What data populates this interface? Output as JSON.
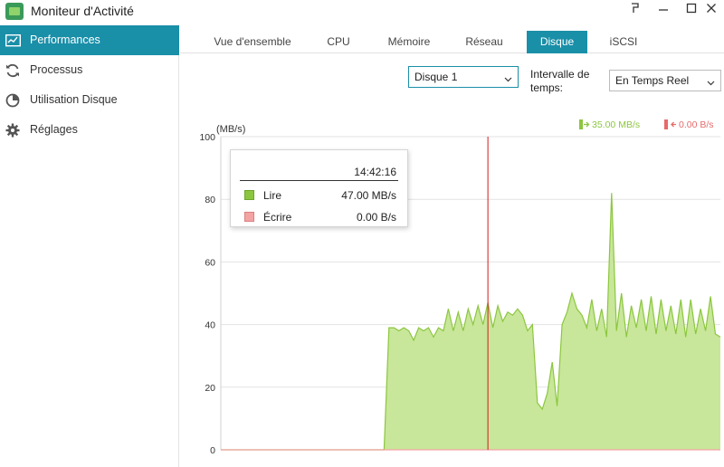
{
  "window": {
    "title": "Moniteur d'Activité",
    "controls": [
      "pin-icon",
      "minimize-icon",
      "maximize-icon",
      "close-icon"
    ]
  },
  "sidebar": {
    "items": [
      {
        "label": "Performances",
        "icon": "performance-monitor-icon",
        "active": true
      },
      {
        "label": "Processus",
        "icon": "refresh-cycle-icon",
        "active": false
      },
      {
        "label": "Utilisation Disque",
        "icon": "disk-pie-icon",
        "active": false
      },
      {
        "label": "Réglages",
        "icon": "gear-icon",
        "active": false
      }
    ]
  },
  "tabs": {
    "items": [
      {
        "label": "Vue d'ensemble"
      },
      {
        "label": "CPU"
      },
      {
        "label": "Mémoire"
      },
      {
        "label": "Réseau"
      },
      {
        "label": "Disque"
      },
      {
        "label": "iSCSI"
      }
    ],
    "active": "Disque"
  },
  "controls": {
    "disk_select": "Disque 1",
    "interval_label": "Intervalle de temps:",
    "interval_select": "En Temps Reel"
  },
  "chart_legend": {
    "read_rate": "35.00 MB/s",
    "write_rate": "0.00 B/s"
  },
  "tooltip": {
    "time": "14:42:16",
    "rows": [
      {
        "name": "Lire",
        "value": "47.00 MB/s"
      },
      {
        "name": "Écrire",
        "value": "0.00 B/s"
      }
    ]
  },
  "colors": {
    "accent": "#1a8fa8",
    "read_fill": "#c8e79a",
    "read_line": "#8cc63f",
    "write_color": "#f4a3a3",
    "marker_line": "#d11a1a",
    "legend_read": "#8cc63f",
    "legend_write": "#e86a6a"
  },
  "chart_data": {
    "type": "area",
    "ylabel": "(MB/s)",
    "ylim": [
      0,
      100
    ],
    "yticks": [
      0,
      20,
      40,
      60,
      80,
      100
    ],
    "grid": true,
    "marker_index": 54,
    "series": [
      {
        "name": "Lire",
        "values": [
          0,
          0,
          0,
          0,
          0,
          0,
          0,
          0,
          0,
          0,
          0,
          0,
          0,
          0,
          0,
          0,
          0,
          0,
          0,
          0,
          0,
          0,
          0,
          0,
          0,
          0,
          0,
          0,
          0,
          0,
          0,
          0,
          0,
          0,
          39,
          39,
          38,
          39,
          38,
          35,
          39,
          38,
          39,
          36,
          39,
          38,
          45,
          38,
          44,
          38,
          45,
          40,
          46,
          40,
          47,
          39,
          46,
          41,
          44,
          43,
          45,
          43,
          38,
          40,
          15,
          13,
          18,
          28,
          14,
          40,
          44,
          50,
          45,
          43,
          39,
          48,
          38,
          45,
          36,
          82,
          38,
          50,
          36,
          46,
          39,
          48,
          38,
          49,
          37,
          48,
          38,
          46,
          37,
          48,
          36,
          48,
          37,
          45,
          38,
          49,
          37,
          36
        ]
      },
      {
        "name": "Écrire",
        "values": [
          0,
          0,
          0,
          0,
          0,
          0,
          0,
          0,
          0,
          0,
          0,
          0,
          0,
          0,
          0,
          0,
          0,
          0,
          0,
          0,
          0,
          0,
          0,
          0,
          0,
          0,
          0,
          0,
          0,
          0,
          0,
          0,
          0,
          0,
          0,
          0,
          0,
          0,
          0,
          0,
          0,
          0,
          0,
          0,
          0,
          0,
          0,
          0,
          0,
          0,
          0,
          0,
          0,
          0,
          0,
          0,
          0,
          0,
          0,
          0,
          0,
          0,
          0,
          0,
          0,
          0,
          0,
          0,
          0,
          0,
          0,
          0,
          0,
          0,
          0,
          0,
          0,
          0,
          0,
          0,
          0,
          0,
          0,
          0,
          0,
          0,
          0,
          0,
          0,
          0,
          0,
          0,
          0,
          0,
          0,
          0,
          0,
          0,
          0,
          0,
          0,
          0
        ]
      }
    ]
  }
}
